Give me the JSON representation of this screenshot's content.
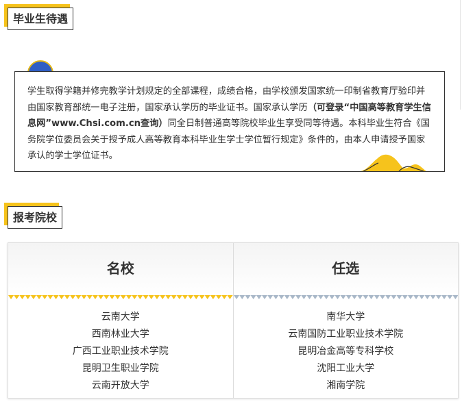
{
  "section1": {
    "title": "毕业生待遇"
  },
  "info": {
    "text_before": "学生取得学籍并修完教学计划规定的全部课程，成绩合格，由学校颁发国家统一印制省教育厅验印并由国家教育部统一电子注册，国家承认学历的毕业证书。国家承认学历",
    "text_bold": "（可登录“中国高等教育学生信息网”www.Chsi.com.cn查询）",
    "text_after": "同全日制普通高等院校毕业生享受同等待遇。本科毕业生符合《国务院学位委员会关于授予成人高等教育本科毕业生学士学位暂行规定》条件的，由本人申请授予国家承认的学士学位证书。"
  },
  "section2": {
    "title": "报考院校"
  },
  "columns": [
    {
      "title": "名校",
      "accent": "#f6c31c",
      "schools": [
        "云南大学",
        "西南林业大学",
        "广西工业职业技术学院",
        "昆明卫生职业学院",
        "云南开放大学"
      ]
    },
    {
      "title": "任选",
      "accent": "#a9b8c8",
      "schools": [
        "南华大学",
        "云南国防工业职业技术学院",
        "昆明冶金高等专科学校",
        "沈阳工业大学",
        "湘南学院"
      ]
    }
  ],
  "colors": {
    "brand_yellow": "#f6c31c",
    "dot_blue": "#2f5ec4",
    "border": "#333333"
  }
}
